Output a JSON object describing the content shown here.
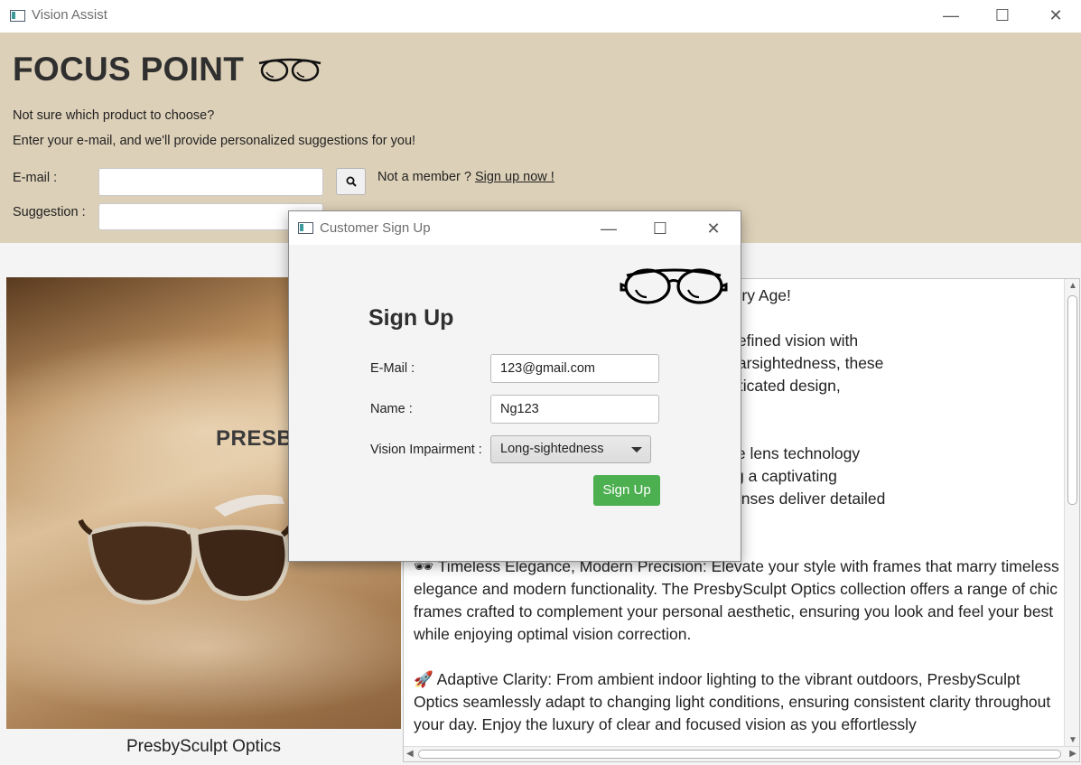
{
  "window": {
    "title": "Vision Assist",
    "controls": {
      "minimize": "—",
      "maximize": "☐",
      "close": "✕"
    }
  },
  "header": {
    "brand": "FOCUS POINT",
    "line1": "Not sure which product to choose?",
    "line2": "Enter your e-mail, and we'll provide personalized suggestions for you!",
    "email_label": "E-mail :",
    "email_value": "",
    "suggestion_label": "Suggestion :",
    "suggestion_value": "",
    "member_text": "Not a member ?",
    "signup_link": "Sign up now !"
  },
  "product": {
    "image_overlay_text": "PRESBY",
    "caption": "PresbySculpt Optics"
  },
  "description": {
    "text": "                                    p for Clear Vision at Every Age!\n\n                                    nd embrace a world of refined vision with\n                                    periencing age-related farsightedness, these\n                                    l technology with sophisticated design,\n                                    clarity.\n\n                                    Optics feature innovative lens technology\n                                    byopia. Whether reading a captivating\n                                    isurely pursuits, these lenses deliver detailed\n                                    our visual experiences.\n\n🕶 Timeless Elegance, Modern Precision: Elevate your style with frames that marry timeless elegance and modern functionality. The PresbySculpt Optics collection offers a range of chic frames crafted to complement your personal aesthetic, ensuring you look and feel your best while enjoying optimal vision correction.\n\n🚀 Adaptive Clarity: From ambient indoor lighting to the vibrant outdoors, PresbySculpt Optics seamlessly adapt to changing light conditions, ensuring consistent clarity throughout your day. Enjoy the luxury of clear and focused vision as you effortlessly"
  },
  "dialog": {
    "title": "Customer Sign Up",
    "heading": "Sign Up",
    "email_label": "E-Mail :",
    "email_value": "123@gmail.com",
    "name_label": "Name :",
    "name_value": "Ng123",
    "impairment_label": "Vision Impairment :",
    "impairment_selected": "Long-sightedness",
    "submit": "Sign Up"
  },
  "colors": {
    "header_bg": "#ddd0b8",
    "accent_button": "#4caf50"
  }
}
